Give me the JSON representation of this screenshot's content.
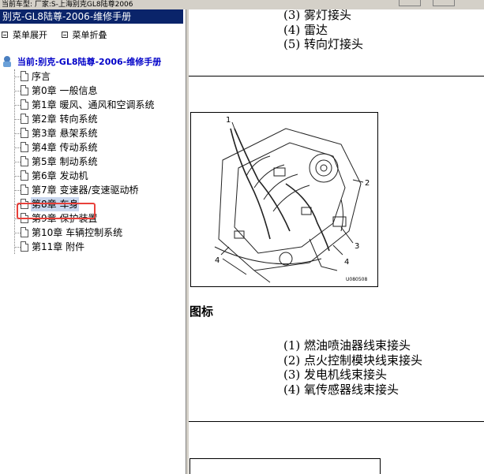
{
  "topbar": {
    "text": "当前车型:  厂家:S-上海别克GL8陆尊2006"
  },
  "left_panel": {
    "title": "别克-GL8陆尊-2006-维修手册",
    "actions": [
      {
        "label": "菜单展开",
        "icon": "expand-icon"
      },
      {
        "label": "菜单折叠",
        "icon": "collapse-icon"
      }
    ],
    "root": {
      "label": "当前:别克-GL8陆尊-2006-维修手册",
      "icon": "book-user-icon"
    },
    "items": [
      {
        "label": "序言"
      },
      {
        "label": "第0章 一般信息"
      },
      {
        "label": "第1章 暖风、通风和空调系统"
      },
      {
        "label": "第2章 转向系统"
      },
      {
        "label": "第3章 悬架系统"
      },
      {
        "label": "第4章 传动系统"
      },
      {
        "label": "第5章 制动系统"
      },
      {
        "label": "第6章 发动机"
      },
      {
        "label": "第7章 变速器/变速驱动桥"
      },
      {
        "label": "第8章 车身",
        "selected": true
      },
      {
        "label": "第9章 保护装置"
      },
      {
        "label": "第10章 车辆控制系统"
      },
      {
        "label": "第11章 附件"
      }
    ]
  },
  "content": {
    "top_list": [
      "(3) 雾灯接头",
      "(4) 雷达",
      "(5) 转向灯接头"
    ],
    "diagram": {
      "callouts": [
        "1",
        "2",
        "3",
        "4",
        "4"
      ],
      "code": "U080508"
    },
    "heading": "图标",
    "legend": [
      "(1) 燃油喷油器线束接头",
      "(2) 点火控制模块线束接头",
      "(3) 发电机线束接头",
      "(4) 氧传感器线束接头"
    ]
  },
  "colors": {
    "title_bar": "#0a246a",
    "selected_bg": "#c9d7ee",
    "highlight": "#e8413b",
    "root_label": "#0000c8"
  }
}
